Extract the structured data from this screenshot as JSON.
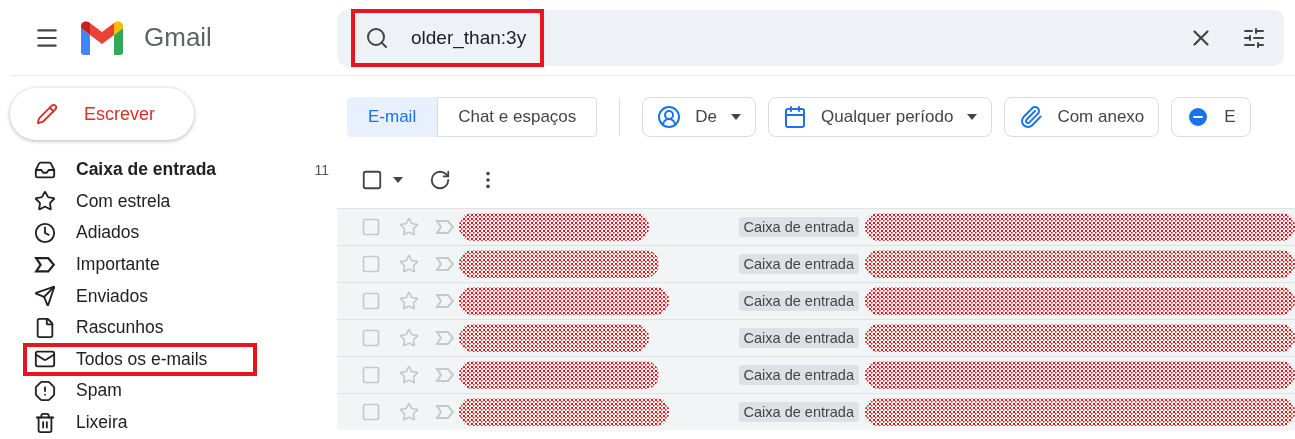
{
  "header": {
    "app_name": "Gmail",
    "search": {
      "value": "older_than:3y",
      "highlighted": true
    }
  },
  "compose": {
    "label": "Escrever"
  },
  "sidebar": {
    "items": [
      {
        "label": "Caixa de entrada",
        "count": "11",
        "unread": true,
        "highlighted": false
      },
      {
        "label": "Com estrela",
        "unread": false,
        "highlighted": false
      },
      {
        "label": "Adiados",
        "unread": false,
        "highlighted": false
      },
      {
        "label": "Importante",
        "unread": false,
        "highlighted": false
      },
      {
        "label": "Enviados",
        "unread": false,
        "highlighted": false
      },
      {
        "label": "Rascunhos",
        "unread": false,
        "highlighted": false
      },
      {
        "label": "Todos os e-mails",
        "unread": false,
        "highlighted": true
      },
      {
        "label": "Spam",
        "unread": false,
        "highlighted": false
      },
      {
        "label": "Lixeira",
        "unread": false,
        "highlighted": false
      }
    ]
  },
  "tabs": [
    {
      "label": "E-mail",
      "selected": true
    },
    {
      "label": "Chat e espaços",
      "selected": false
    }
  ],
  "filters": [
    {
      "label": "De",
      "dropdown": true
    },
    {
      "label": "Qualquer período",
      "dropdown": true
    },
    {
      "label": "Com anexo",
      "dropdown": false
    },
    {
      "label": "E",
      "dropdown": false
    }
  ],
  "select_all": {
    "checked": false
  },
  "messages": [
    {
      "label": "Caixa de entrada",
      "redacted": true,
      "checked": false
    },
    {
      "label": "Caixa de entrada",
      "redacted": true,
      "checked": false
    },
    {
      "label": "Caixa de entrada",
      "redacted": true,
      "checked": false
    },
    {
      "label": "Caixa de entrada",
      "redacted": true,
      "checked": false
    },
    {
      "label": "Caixa de entrada",
      "redacted": true,
      "checked": false
    },
    {
      "label": "Caixa de entrada",
      "redacted": true,
      "checked": false
    }
  ]
}
